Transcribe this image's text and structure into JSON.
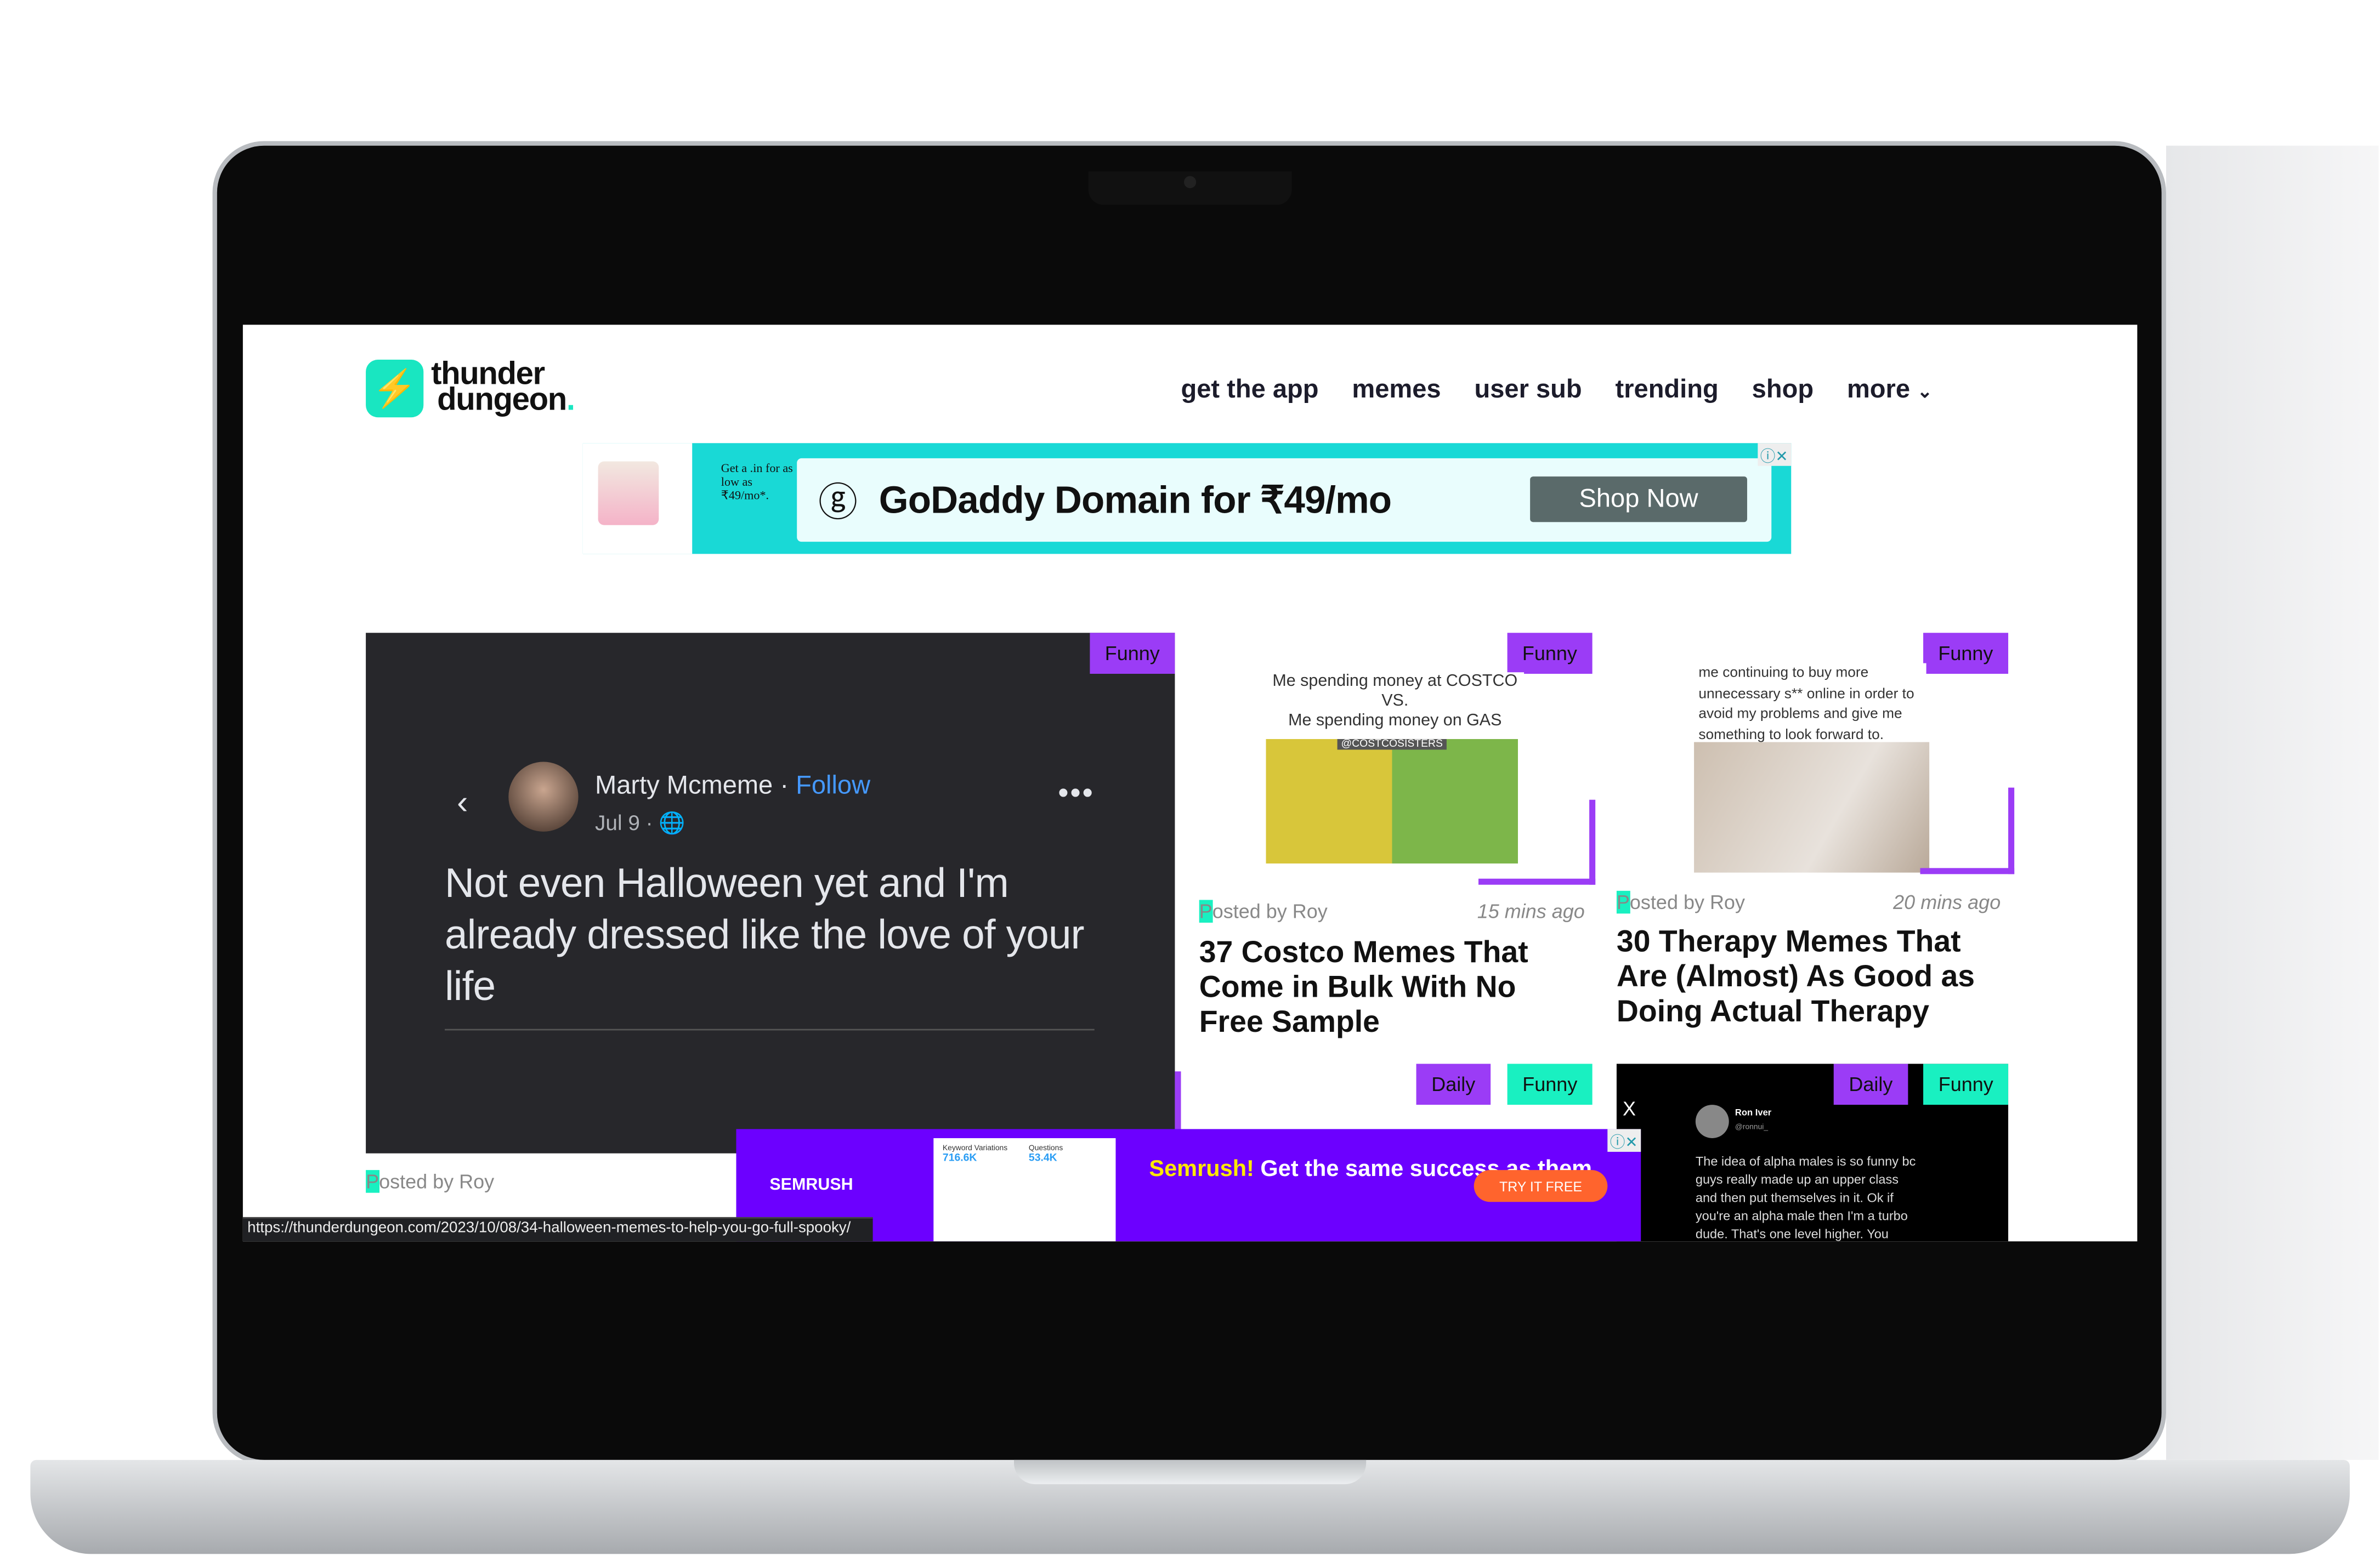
{
  "site": {
    "logo_line1": "thunder",
    "logo_line2": "dungeon",
    "logo_dot": "."
  },
  "nav": [
    "get the app",
    "memes",
    "user sub",
    "trending",
    "shop",
    "more"
  ],
  "ad_top": {
    "mini_text": "Get a .in for as low as ₹49/mo*.",
    "headline": "GoDaddy Domain for ₹49/mo",
    "cta": "Shop Now",
    "close": "ⓘ✕"
  },
  "feature": {
    "badge": "Funny",
    "post": {
      "name": "Marty Mcmeme",
      "follow": "Follow",
      "date": "Jul 9 · 🌐",
      "text": "Not even Halloween yet and I'm already dressed like the love of your life"
    },
    "posted_by": "Posted by Roy"
  },
  "cards": [
    {
      "badge": "Funny",
      "meme_caption": "Me spending money at COSTCO\nVS.\nMe spending money on GAS",
      "meme_tag": "@COSTCOSISTERS",
      "posted_by": "Posted by Roy",
      "ago": "15 mins ago",
      "title": "37 Costco Memes That Come in Bulk With No Free Sample"
    },
    {
      "badge": "Funny",
      "meme_caption": "me continuing to buy more unnecessary s** online in order to avoid my problems and give me something to look forward to.",
      "posted_by": "Posted by Roy",
      "ago": "20 mins ago",
      "title": "30 Therapy Memes That Are (Almost) As Good as Doing Actual Therapy"
    }
  ],
  "lower_badges": {
    "daily": "Daily",
    "funny": "Funny"
  },
  "tweet": {
    "close": "X",
    "name": "Ron Iver",
    "handle": "@ronnui_",
    "text": "The idea of alpha males is so funny bc guys really made up an upper class and then put themselves in it. Ok if you're an alpha male then I'm a turbo dude. That's one level higher. You"
  },
  "ad_bottom": {
    "logo": "SEMRUSH",
    "col1": "Keyword Variations",
    "val1": "716.6K",
    "col2": "Questions",
    "val2": "53.4K",
    "brand": "Semrush!",
    "msg": "Get the same success as them",
    "cta": "TRY IT FREE",
    "close": "ⓘ✕"
  },
  "status_url": "https://thunderdungeon.com/2023/10/08/34-halloween-memes-to-help-you-go-full-spooky/"
}
